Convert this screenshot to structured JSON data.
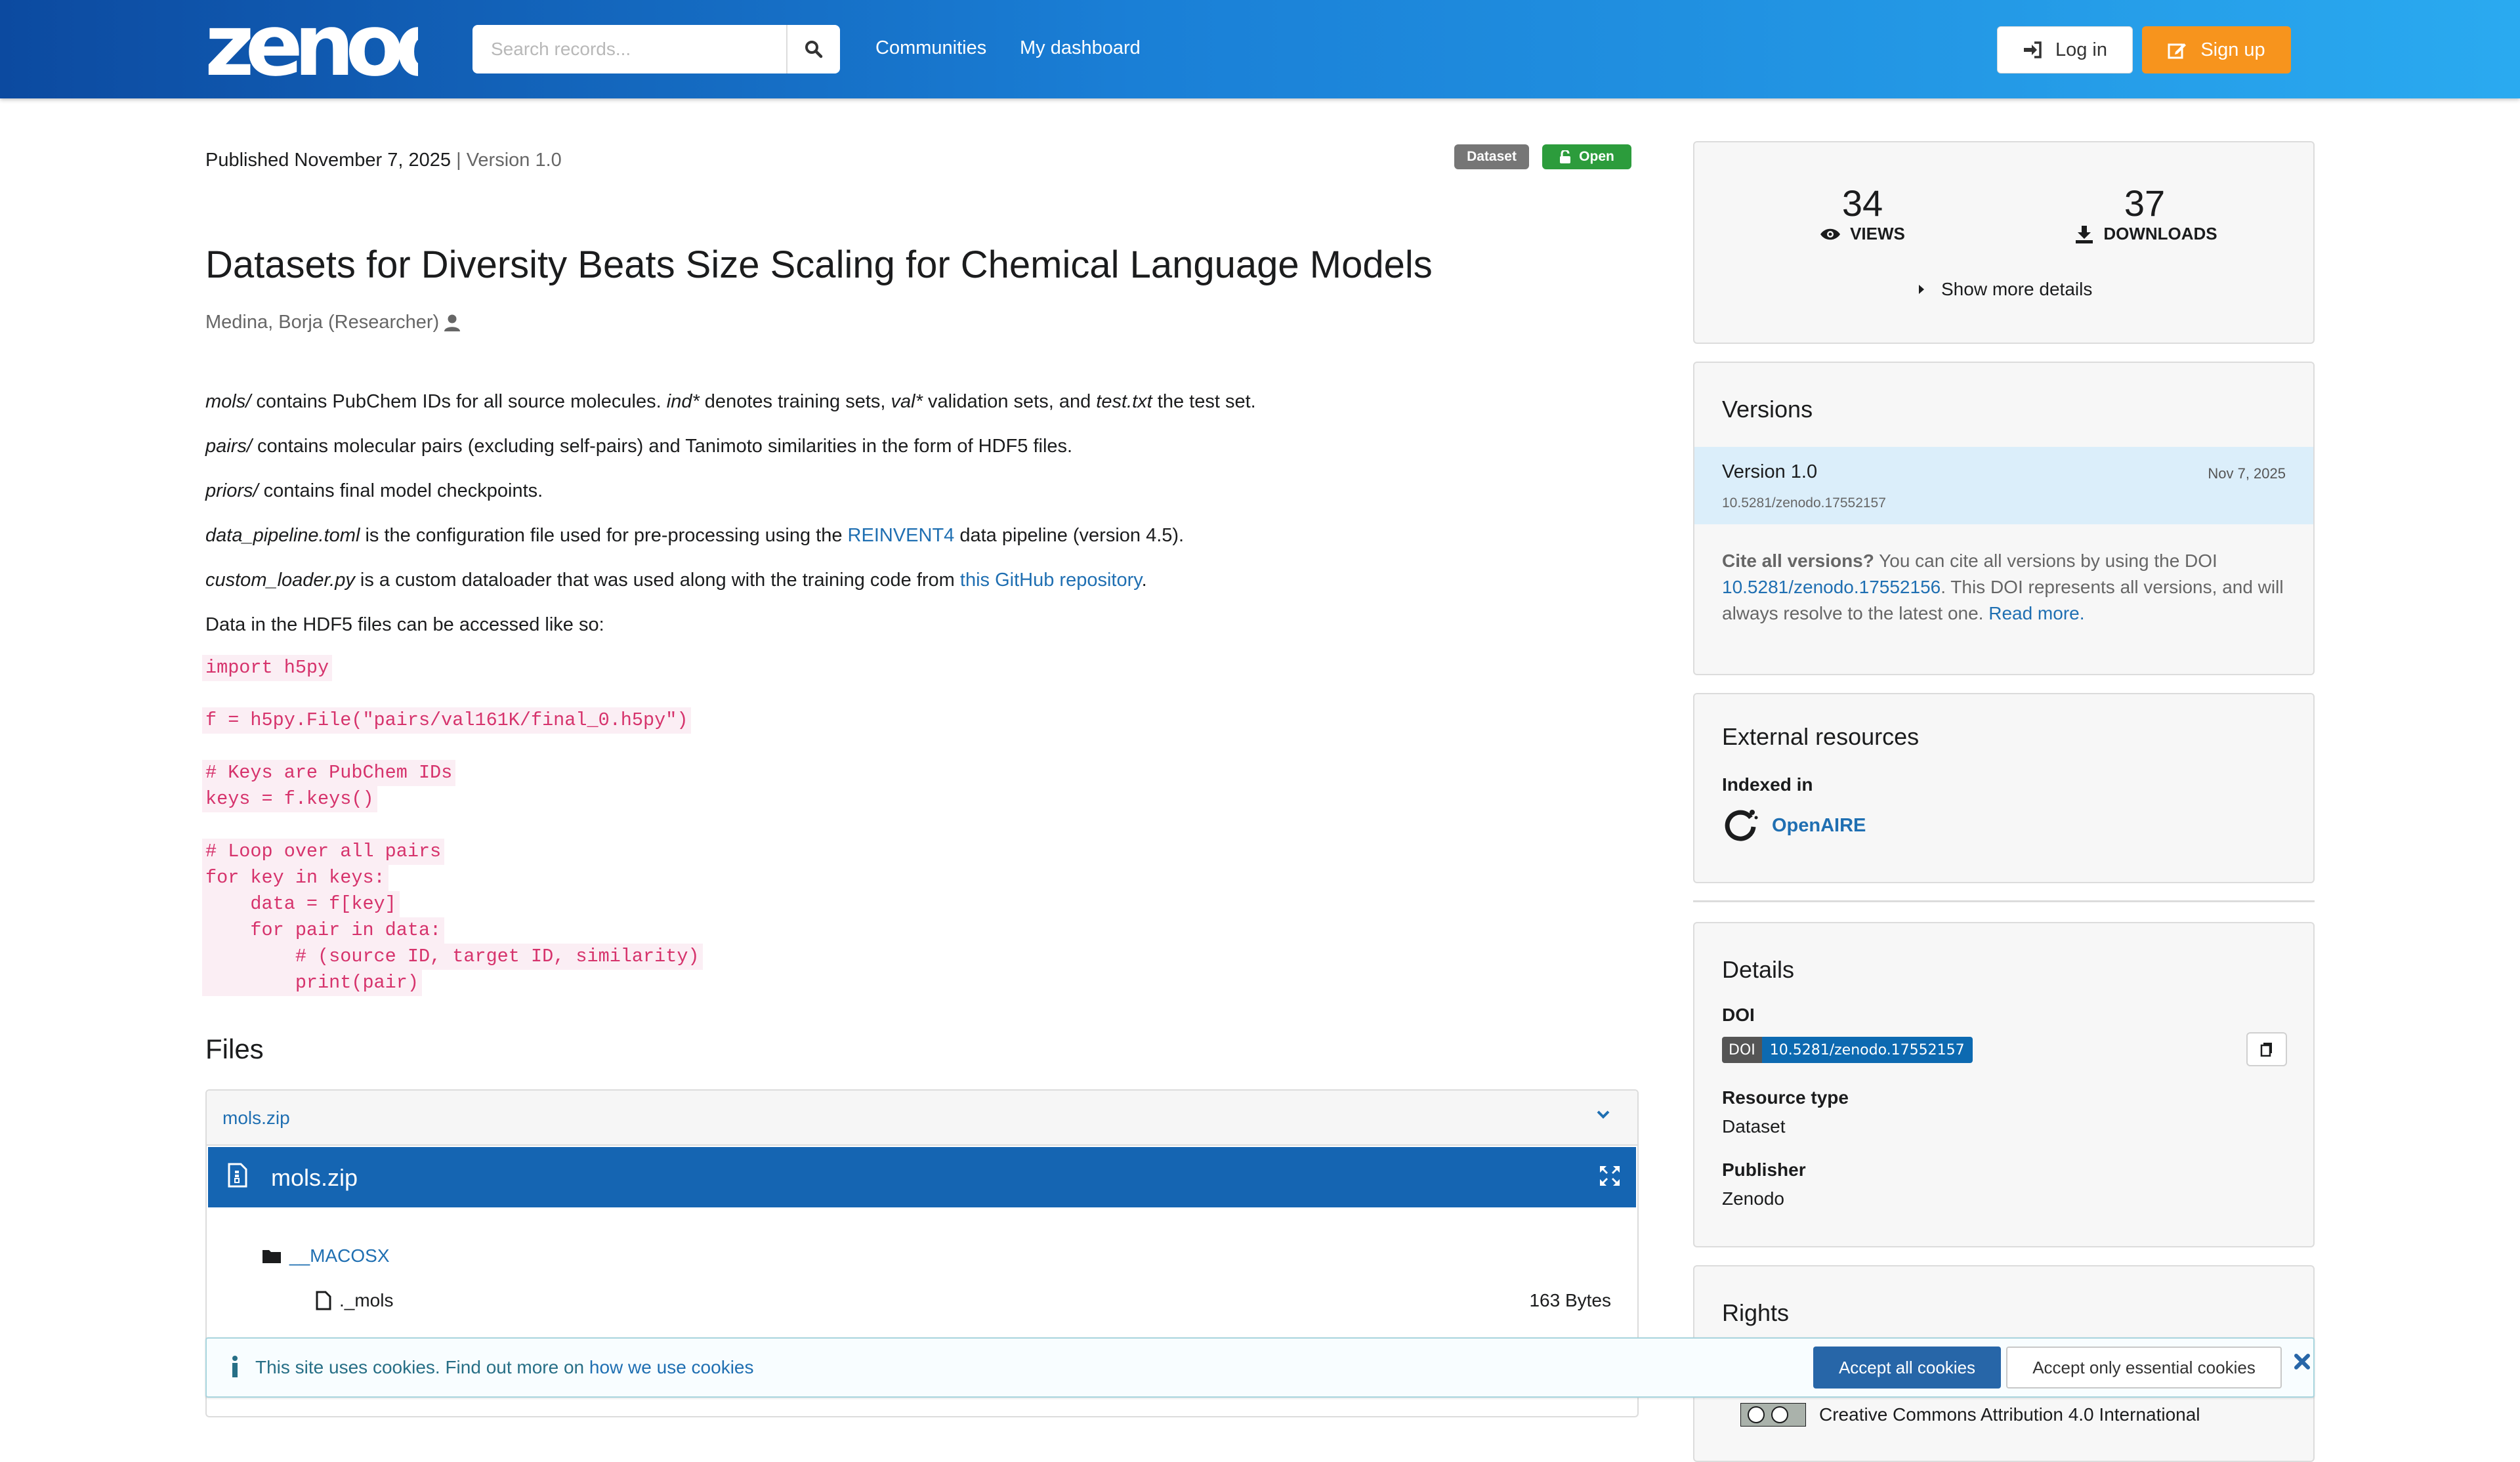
{
  "header": {
    "logo_text": "zenodo",
    "search_placeholder": "Search records...",
    "nav": [
      "Communities",
      "My dashboard"
    ],
    "login_label": "Log in",
    "signup_label": "Sign up"
  },
  "record": {
    "published": "Published November 7, 2025",
    "separator": "|",
    "version": "Version 1.0",
    "badges": [
      "Dataset",
      "Open"
    ],
    "title": "Datasets for Diversity Beats Size Scaling for Chemical Language Models",
    "author": "Medina, Borja (Researcher)"
  },
  "description": {
    "p1": {
      "a": "mols/",
      "b": " contains PubChem IDs for all source molecules. ",
      "c": "ind*",
      "d": " denotes training sets, ",
      "e": "val*",
      "f": " validation sets, and ",
      "g": "test.txt",
      "h": " the test set."
    },
    "p2": {
      "a": "pairs/",
      "b": " contains molecular pairs (excluding self-pairs) and Tanimoto similarities in the form of HDF5 files."
    },
    "p3": {
      "a": "priors/",
      "b": " contains final model checkpoints."
    },
    "p4": {
      "a": "data_pipeline.toml",
      "b": " is the configuration file used for pre-processing using the ",
      "link": "REINVENT4",
      "c": " data pipeline (version 4.5)."
    },
    "p5": {
      "a": "custom_loader.py",
      "b": " is a custom dataloader that was used along with the training code from ",
      "link": "this GitHub repository",
      "c": "."
    },
    "p6": "Data in the HDF5 files can be accessed like so:",
    "code": [
      "import h5py",
      "",
      "f = h5py.File(\"pairs/val161K/final_0.h5py\")",
      "",
      "# Keys are PubChem IDs",
      "keys = f.keys()",
      "",
      "# Loop over all pairs",
      "for key in keys:",
      "    data = f[key]",
      "    for pair in data:",
      "        # (source ID, target ID, similarity)",
      "        print(pair)"
    ]
  },
  "files": {
    "heading": "Files",
    "accordion_name": "mols.zip",
    "preview_name": "mols.zip",
    "tree": [
      {
        "name": "__MACOSX",
        "type": "folder"
      },
      {
        "name": "._mols",
        "type": "file",
        "size": "163 Bytes"
      }
    ]
  },
  "stats": {
    "views": "34",
    "views_label": "VIEWS",
    "downloads": "37",
    "downloads_label": "DOWNLOADS",
    "show_more": "Show more details"
  },
  "versions": {
    "title": "Versions",
    "current": {
      "name": "Version 1.0",
      "doi": "10.5281/zenodo.17552157",
      "date": "Nov 7, 2025"
    },
    "cite_bold": "Cite all versions?",
    "cite_text1": " You can cite all versions by using the DOI ",
    "cite_doi": "10.5281/zenodo.17552156",
    "cite_text2": ". This DOI represents all versions, and will always resolve to the latest one. ",
    "read_more": "Read more."
  },
  "external": {
    "title": "External resources",
    "indexed_label": "Indexed in",
    "indexed_name": "OpenAIRE"
  },
  "details": {
    "title": "Details",
    "doi_label": "DOI",
    "doi_badge_left": "DOI",
    "doi_badge_right": "10.5281/zenodo.17552157",
    "resource_type_label": "Resource type",
    "resource_type": "Dataset",
    "publisher_label": "Publisher",
    "publisher": "Zenodo"
  },
  "rights": {
    "title": "Rights",
    "license": "Creative Commons Attribution 4.0 International"
  },
  "cookie": {
    "text": "This site uses cookies. Find out more on ",
    "link": "how we use cookies",
    "accept_all": "Accept all cookies",
    "accept_essential": "Accept only essential cookies"
  },
  "colors": {
    "header_start": "#0c4aa0",
    "header_end": "#2aaaf0",
    "signup": "#f7941d",
    "open_badge": "#2c9c3c",
    "file_bar": "#1565b2",
    "link": "#1f6fb2"
  }
}
